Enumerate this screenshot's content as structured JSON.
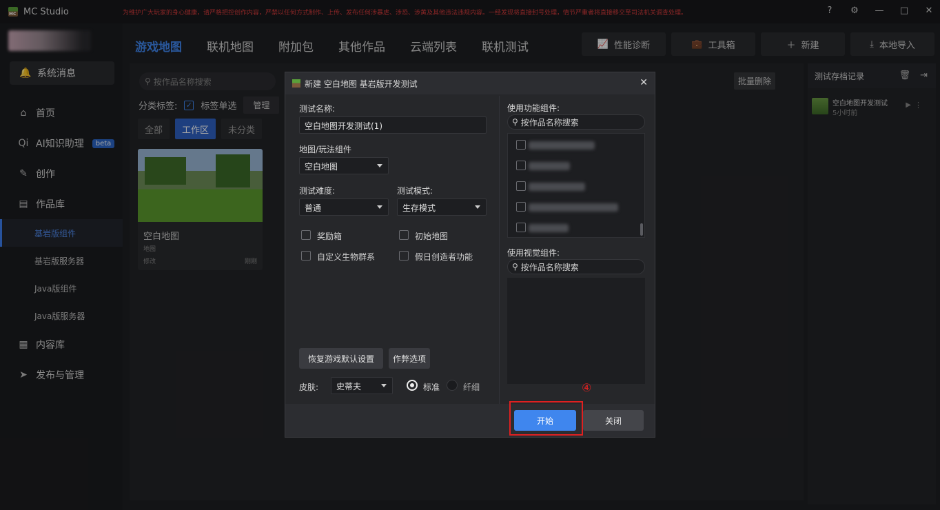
{
  "app": {
    "title": "MC Studio",
    "notice": "为维护广大玩家的身心健康，请严格把控创作内容，严禁以任何方式制作、上传、发布任何涉暴虐、涉恐、涉黄及其他违法违规内容。一经发现将直接封号处理，情节严重者将直接移交至司法机关调查处理。",
    "window_controls": [
      "?",
      "⚙",
      "—",
      "□",
      "✕"
    ]
  },
  "sidebar": {
    "system_messages": "系统消息",
    "items": [
      {
        "label": "首页",
        "icon": "home-icon"
      },
      {
        "label": "AI知识助理",
        "icon": "ai-icon",
        "badge": "beta"
      },
      {
        "label": "创作",
        "icon": "pen-icon"
      },
      {
        "label": "作品库",
        "icon": "folder-icon"
      }
    ],
    "subitems": [
      "基岩版组件",
      "基岩版服务器",
      "Java版组件",
      "Java版服务器"
    ],
    "active_sub": 0,
    "bottom_items": [
      {
        "label": "内容库",
        "icon": "grid-icon"
      },
      {
        "label": "发布与管理",
        "icon": "send-icon"
      }
    ]
  },
  "topbar": {
    "tabs": [
      "游戏地图",
      "联机地图",
      "附加包",
      "其他作品",
      "云端列表",
      "联机测试"
    ],
    "active_tab": 0,
    "tools": [
      {
        "label": "性能诊断",
        "icon": "chart-icon"
      },
      {
        "label": "工具箱",
        "icon": "toolbox-icon"
      },
      {
        "label": "新建",
        "icon": "plus-icon"
      },
      {
        "label": "本地导入",
        "icon": "download-icon"
      }
    ]
  },
  "content": {
    "search_placeholder": "按作品名称搜索",
    "category_label": "分类标签:",
    "tag_single": "标签单选",
    "manage": "管理",
    "filters": [
      "全部",
      "工作区",
      "未分类"
    ],
    "active_filter": 1,
    "batch_delete": "批量删除",
    "card": {
      "title": "空白地图",
      "type": "地图",
      "modified": "修改",
      "time": "刚刚"
    }
  },
  "right_panel": {
    "title": "测试存档记录",
    "record": {
      "name": "空白地图开发测试",
      "time": "5小时前"
    }
  },
  "dialog": {
    "title": "新建 空白地图 基岩版开发测试",
    "test_name_label": "测试名称:",
    "test_name_value": "空白地图开发测试(1)",
    "map_label": "地图/玩法组件",
    "map_value": "空白地图",
    "difficulty_label": "测试难度:",
    "difficulty_value": "普通",
    "mode_label": "测试模式:",
    "mode_value": "生存模式",
    "checkboxes": [
      "奖励箱",
      "初始地图",
      "自定义生物群系",
      "假日创造者功能"
    ],
    "reset_button": "恢复游戏默认设置",
    "cheat_button": "作弊选项",
    "skin_label": "皮肤:",
    "skin_value": "史蒂夫",
    "skin_options": [
      "标准",
      "纤细"
    ],
    "func_comp_label": "使用功能组件:",
    "func_search_placeholder": "按作品名称搜索",
    "view_comp_label": "使用视觉组件:",
    "view_search_placeholder": "按作品名称搜索",
    "start_button": "开始",
    "close_button": "关闭"
  },
  "annotation": {
    "number": "④"
  }
}
